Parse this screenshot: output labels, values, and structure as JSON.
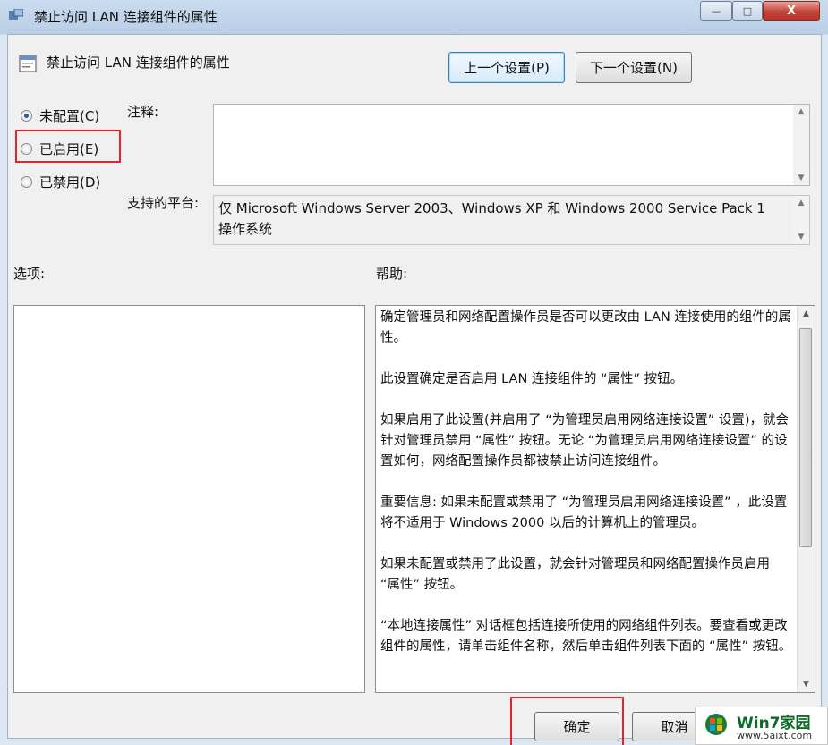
{
  "window": {
    "title": "禁止访问 LAN 连接组件的属性",
    "close_glyph": "X",
    "min_glyph": "—",
    "max_glyph": "□"
  },
  "header": {
    "policy_title": "禁止访问 LAN 连接组件的属性",
    "prev_button": "上一个设置(P)",
    "next_button": "下一个设置(N)"
  },
  "state": {
    "options": [
      {
        "label": "未配置(C)",
        "selected": true
      },
      {
        "label": "已启用(E)",
        "selected": false
      },
      {
        "label": "已禁用(D)",
        "selected": false
      }
    ]
  },
  "labels": {
    "comment": "注释:",
    "platform": "支持的平台:",
    "options": "选项:",
    "help": "帮助:"
  },
  "comment_value": "",
  "platform_text": "仅 Microsoft Windows Server 2003、Windows XP 和 Windows 2000 Service Pack 1 操作系统",
  "help_paragraphs": [
    "确定管理员和网络配置操作员是否可以更改由 LAN 连接使用的组件的属性。",
    "此设置确定是否启用 LAN 连接组件的 “属性” 按钮。",
    "如果启用了此设置(并启用了 “为管理员启用网络连接设置” 设置)，就会针对管理员禁用 “属性” 按钮。无论 “为管理员启用网络连接设置” 的设置如何，网络配置操作员都被禁止访问连接组件。",
    "重要信息: 如果未配置或禁用了 “为管理员启用网络连接设置” ，此设置将不适用于 Windows 2000 以后的计算机上的管理员。",
    "如果未配置或禁用了此设置，就会针对管理员和网络配置操作员启用 “属性” 按钮。",
    " “本地连接属性” 对话框包括连接所使用的网络组件列表。要查看或更改组件的属性，请单击组件名称，然后单击组件列表下面的 “属性” 按钮。"
  ],
  "footer": {
    "ok_button": "确定",
    "cancel_button": "取消"
  },
  "watermark": {
    "brand": "Win7家园",
    "site": "www.5aixt.com"
  },
  "colors": {
    "highlight_red": "#e2262d",
    "focus_blue": "#3c7fb1"
  }
}
